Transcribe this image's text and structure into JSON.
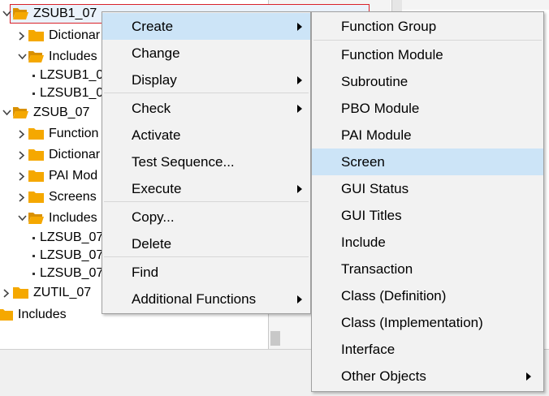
{
  "tree": {
    "nodes": [
      {
        "label": "ZSUB1_07",
        "level": 0,
        "expanded": true,
        "selected": true
      },
      {
        "label": "Dictionar",
        "level": 1,
        "expanded": false
      },
      {
        "label": "Includes",
        "level": 1,
        "expanded": true
      },
      {
        "label": "LZSUB1_0",
        "level": 2,
        "leaf": true
      },
      {
        "label": "LZSUB1_0",
        "level": 2,
        "leaf": true
      },
      {
        "label": "ZSUB_07",
        "level": 0,
        "expanded": true
      },
      {
        "label": "Function",
        "level": 1,
        "expanded": false
      },
      {
        "label": "Dictionar",
        "level": 1,
        "expanded": false
      },
      {
        "label": "PAI Mod",
        "level": 1,
        "expanded": false
      },
      {
        "label": "Screens",
        "level": 1,
        "expanded": false
      },
      {
        "label": "Includes",
        "level": 1,
        "expanded": true
      },
      {
        "label": "LZSUB_07",
        "level": 2,
        "leaf": true
      },
      {
        "label": "LZSUB_07",
        "level": 2,
        "leaf": true
      },
      {
        "label": "LZSUB_07",
        "level": 2,
        "leaf": true
      },
      {
        "label": "ZUTIL_07",
        "level": 0,
        "expanded": false
      },
      {
        "label": "Includes",
        "level": -1,
        "expanded": false
      }
    ]
  },
  "context_menu": {
    "items": [
      {
        "label": "Create",
        "submenu": true,
        "highlighted": true
      },
      {
        "label": "Change",
        "submenu": false
      },
      {
        "label": "Display",
        "submenu": true
      },
      {
        "label": "Check",
        "submenu": true
      },
      {
        "label": "Activate",
        "submenu": false
      },
      {
        "label": "Test Sequence...",
        "submenu": false
      },
      {
        "label": "Execute",
        "submenu": true
      },
      {
        "label": "Copy...",
        "submenu": false
      },
      {
        "label": "Delete",
        "submenu": false
      },
      {
        "label": "Find",
        "submenu": false
      },
      {
        "label": "Additional Functions",
        "submenu": true
      }
    ]
  },
  "create_submenu": {
    "items": [
      {
        "label": "Function Group"
      },
      {
        "label": "Function Module"
      },
      {
        "label": "Subroutine"
      },
      {
        "label": "PBO Module"
      },
      {
        "label": "PAI Module"
      },
      {
        "label": "Screen",
        "highlighted": true
      },
      {
        "label": "GUI Status"
      },
      {
        "label": "GUI Titles"
      },
      {
        "label": "Include"
      },
      {
        "label": "Transaction"
      },
      {
        "label": "Class (Definition)"
      },
      {
        "label": "Class (Implementation)"
      },
      {
        "label": "Interface"
      },
      {
        "label": "Other Objects",
        "submenu": true
      }
    ]
  },
  "colors": {
    "folder": "#f5a800",
    "selection_border": "#d9222a",
    "menu_background": "#f2f2f2",
    "menu_highlight": "#cce4f7"
  },
  "icons": {
    "folder": "folder-icon",
    "folder_open": "folder-open-icon",
    "expand": "chevron-right-icon",
    "collapse": "chevron-down-icon",
    "submenu": "submenu-arrow-icon"
  }
}
